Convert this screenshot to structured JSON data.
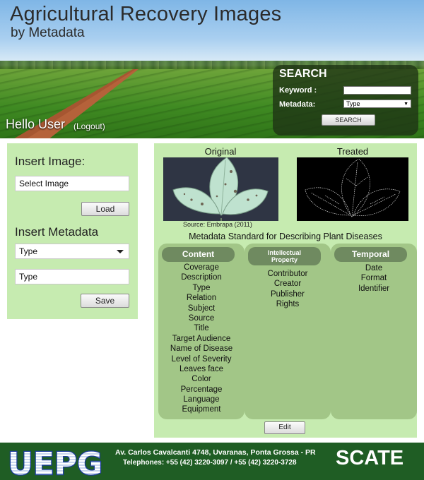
{
  "header": {
    "title": "Agricultural Recovery Images",
    "subtitle": "by Metadata",
    "greeting": "Hello User",
    "logout_label": "(Logout)"
  },
  "search": {
    "title": "SEARCH",
    "keyword_label": "Keyword :",
    "keyword_value": "",
    "metadata_label": "Metadata:",
    "metadata_selected": "Type",
    "button_label": "SEARCH"
  },
  "left_panel": {
    "insert_image_heading": "Insert Image:",
    "select_image_value": "Select Image",
    "load_label": "Load",
    "insert_metadata_heading": "Insert Metadata",
    "metadata_select_value": "Type",
    "metadata_input_value": "Type",
    "save_label": "Save"
  },
  "main": {
    "original_label": "Original",
    "treated_label": "Treated",
    "source": "Source: Embrapa (2011)",
    "standard_title": "Metadata Standard for Describing Plant Diseases",
    "edit_label": "Edit"
  },
  "columns": [
    {
      "title": "Content",
      "items": [
        "Coverage",
        "Description",
        "Type",
        "Relation",
        "Subject",
        "Source",
        "Title",
        "Target Audience",
        "Name of Disease",
        "Level of Severity",
        "Leaves face",
        "Color",
        "Percentage",
        "Language",
        "Equipment"
      ]
    },
    {
      "title_line1": "Intellectual",
      "title_line2": "Property",
      "items": [
        "Contributor",
        "Creator",
        "Publisher",
        "Rights"
      ]
    },
    {
      "title": "Temporal",
      "items": [
        "Date",
        "Format",
        "Identifier"
      ]
    }
  ],
  "footer": {
    "logo_text": "UEPG",
    "address": "Av. Carlos Cavalcanti 4748, Uvaranas, Ponta Grossa - PR",
    "phones": "Telephones: +55 (42) 3220-3097 / +55 (42) 3220-3728",
    "brand": "SCATE"
  },
  "colors": {
    "panel_bg": "#c6ebb0",
    "column_bg": "#a2c687",
    "column_header": "#6f8a60",
    "footer_bg": "#1f5d24"
  }
}
